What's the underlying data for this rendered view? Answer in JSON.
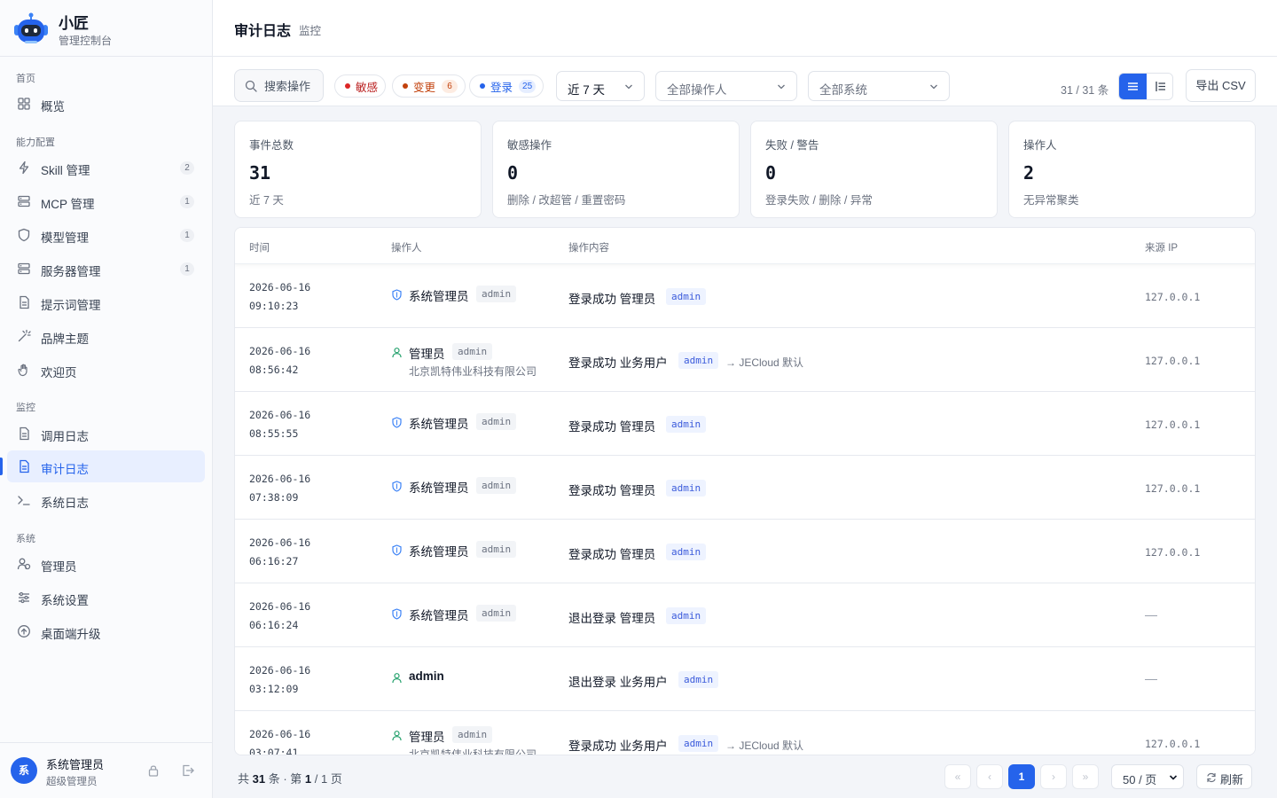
{
  "brand": {
    "name": "小匠",
    "subtitle": "管理控制台"
  },
  "sidebar": {
    "sections": [
      {
        "title": "首页",
        "items": [
          {
            "label": "概览",
            "icon": "grid-icon"
          }
        ]
      },
      {
        "title": "能力配置",
        "items": [
          {
            "label": "Skill 管理",
            "icon": "lightning-icon",
            "count": "2"
          },
          {
            "label": "MCP 管理",
            "icon": "server-icon",
            "count": "1"
          },
          {
            "label": "模型管理",
            "icon": "shield-icon",
            "count": "1"
          },
          {
            "label": "服务器管理",
            "icon": "server-icon",
            "count": "1"
          },
          {
            "label": "提示词管理",
            "icon": "document-icon"
          },
          {
            "label": "品牌主题",
            "icon": "wand-icon"
          },
          {
            "label": "欢迎页",
            "icon": "hand-icon"
          }
        ]
      },
      {
        "title": "监控",
        "items": [
          {
            "label": "调用日志",
            "icon": "document-icon"
          },
          {
            "label": "审计日志",
            "icon": "document-icon",
            "active": true
          },
          {
            "label": "系统日志",
            "icon": "terminal-icon"
          }
        ]
      },
      {
        "title": "系统",
        "items": [
          {
            "label": "管理员",
            "icon": "users-icon"
          },
          {
            "label": "系统设置",
            "icon": "sliders-icon"
          },
          {
            "label": "桌面端升级",
            "icon": "upgrade-icon"
          }
        ]
      }
    ]
  },
  "user": {
    "avatar": "系",
    "name": "系统管理员",
    "role": "超级管理员"
  },
  "header": {
    "title": "审计日志",
    "crumb": "监控"
  },
  "filters": {
    "search_placeholder": "搜索操作",
    "chips": [
      {
        "label": "敏感",
        "color": "#dc2626",
        "count": ""
      },
      {
        "label": "变更",
        "color": "#c2410c",
        "count": "6"
      },
      {
        "label": "登录",
        "color": "#2563eb",
        "count": "25"
      }
    ],
    "range": "近 7 天",
    "operator": "全部操作人",
    "system": "全部系统",
    "count_text": "31 / 31 条",
    "export_label": "导出 CSV"
  },
  "stats": [
    {
      "label": "事件总数",
      "value": "31",
      "sub": "近 7 天"
    },
    {
      "label": "敏感操作",
      "value": "0",
      "sub": "删除 / 改超管 / 重置密码"
    },
    {
      "label": "失败 / 警告",
      "value": "0",
      "sub": "登录失败 / 删除 / 异常"
    },
    {
      "label": "操作人",
      "value": "2",
      "sub": "无异常聚类"
    }
  ],
  "table": {
    "columns": [
      "时间",
      "操作人",
      "操作内容",
      "来源 IP"
    ],
    "rows": [
      {
        "date": "2026-06-16",
        "time": "09:10:23",
        "op_type": "shield",
        "op_name": "系统管理员",
        "op_badge": "admin",
        "org": "",
        "content": "登录成功 管理员",
        "tag": "admin",
        "suffix": "",
        "ip": "127.0.0.1"
      },
      {
        "date": "2026-06-16",
        "time": "08:56:42",
        "op_type": "user",
        "op_name": "管理员",
        "op_badge": "admin",
        "org": "北京凯特伟业科技有限公司",
        "content": "登录成功 业务用户",
        "tag": "admin",
        "suffix": "→ JECloud 默认",
        "ip": "127.0.0.1"
      },
      {
        "date": "2026-06-16",
        "time": "08:55:55",
        "op_type": "shield",
        "op_name": "系统管理员",
        "op_badge": "admin",
        "org": "",
        "content": "登录成功 管理员",
        "tag": "admin",
        "suffix": "",
        "ip": "127.0.0.1"
      },
      {
        "date": "2026-06-16",
        "time": "07:38:09",
        "op_type": "shield",
        "op_name": "系统管理员",
        "op_badge": "admin",
        "org": "",
        "content": "登录成功 管理员",
        "tag": "admin",
        "suffix": "",
        "ip": "127.0.0.1"
      },
      {
        "date": "2026-06-16",
        "time": "06:16:27",
        "op_type": "shield",
        "op_name": "系统管理员",
        "op_badge": "admin",
        "org": "",
        "content": "登录成功 管理员",
        "tag": "admin",
        "suffix": "",
        "ip": "127.0.0.1"
      },
      {
        "date": "2026-06-16",
        "time": "06:16:24",
        "op_type": "shield",
        "op_name": "系统管理员",
        "op_badge": "admin",
        "org": "",
        "content": "退出登录 管理员",
        "tag": "admin",
        "suffix": "",
        "ip": ""
      },
      {
        "date": "2026-06-16",
        "time": "03:12:09",
        "op_type": "user",
        "op_name": "admin",
        "op_badge": "",
        "org": "",
        "content": "退出登录 业务用户",
        "tag": "admin",
        "suffix": "",
        "ip": ""
      },
      {
        "date": "2026-06-16",
        "time": "03:07:41",
        "op_type": "user",
        "op_name": "管理员",
        "op_badge": "admin",
        "org": "北京凯特伟业科技有限公司",
        "content": "登录成功 业务用户",
        "tag": "admin",
        "suffix": "→ JECloud 默认",
        "ip": "127.0.0.1"
      }
    ]
  },
  "footer": {
    "total_prefix": "共",
    "total": "31",
    "total_mid": "条 · 第",
    "page": "1",
    "page_sep": "/",
    "pages": "1",
    "page_suffix": "页",
    "pager": {
      "first": "«",
      "prev": "‹",
      "current": "1",
      "next": "›",
      "last": "»"
    },
    "page_size": "50 / 页",
    "refresh_label": "刷新"
  }
}
